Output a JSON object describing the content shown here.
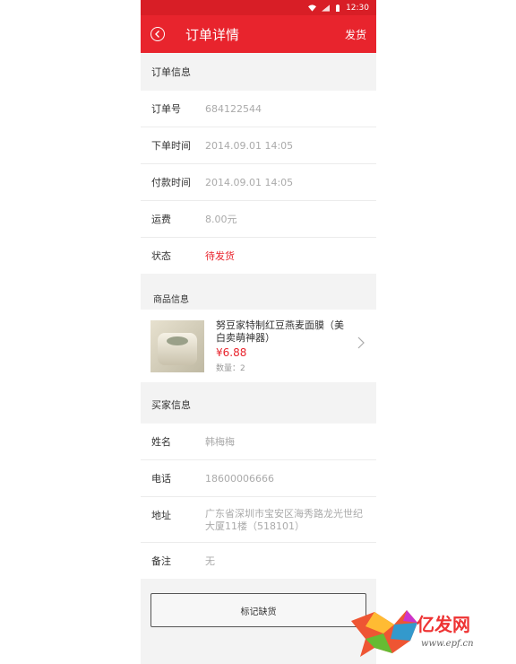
{
  "status_bar": {
    "time": "12:30"
  },
  "header": {
    "title": "订单详情",
    "action": "发货"
  },
  "order": {
    "heading": "订单信息",
    "rows": [
      {
        "label": "订单号",
        "value": "684122544"
      },
      {
        "label": "下单时间",
        "value": "2014.09.01  14:05"
      },
      {
        "label": "付款时间",
        "value": "2014.09.01  14:05"
      },
      {
        "label": "运费",
        "value": "8.00元"
      },
      {
        "label": "状态",
        "value": "待发货"
      }
    ]
  },
  "goods": {
    "heading": "商品信息",
    "name": "努豆家特制红豆燕麦面膜（美白卖萌神器）",
    "price": "¥6.88",
    "quantity": "数量：2"
  },
  "buyer": {
    "heading": "买家信息",
    "rows": [
      {
        "label": "姓名",
        "value": "韩梅梅"
      },
      {
        "label": "电话",
        "value": "18600006666"
      },
      {
        "label": "地址",
        "value": "广东省深圳市宝安区海秀路龙光世纪大厦11楼（518101）"
      },
      {
        "label": "备注",
        "value": "无"
      }
    ]
  },
  "button": {
    "label": "标记缺货"
  },
  "watermark": {
    "text": "亿发网",
    "url": "www.epf.cn"
  },
  "colors": {
    "accent": "#e8242d",
    "status_bar": "#d81e26"
  }
}
